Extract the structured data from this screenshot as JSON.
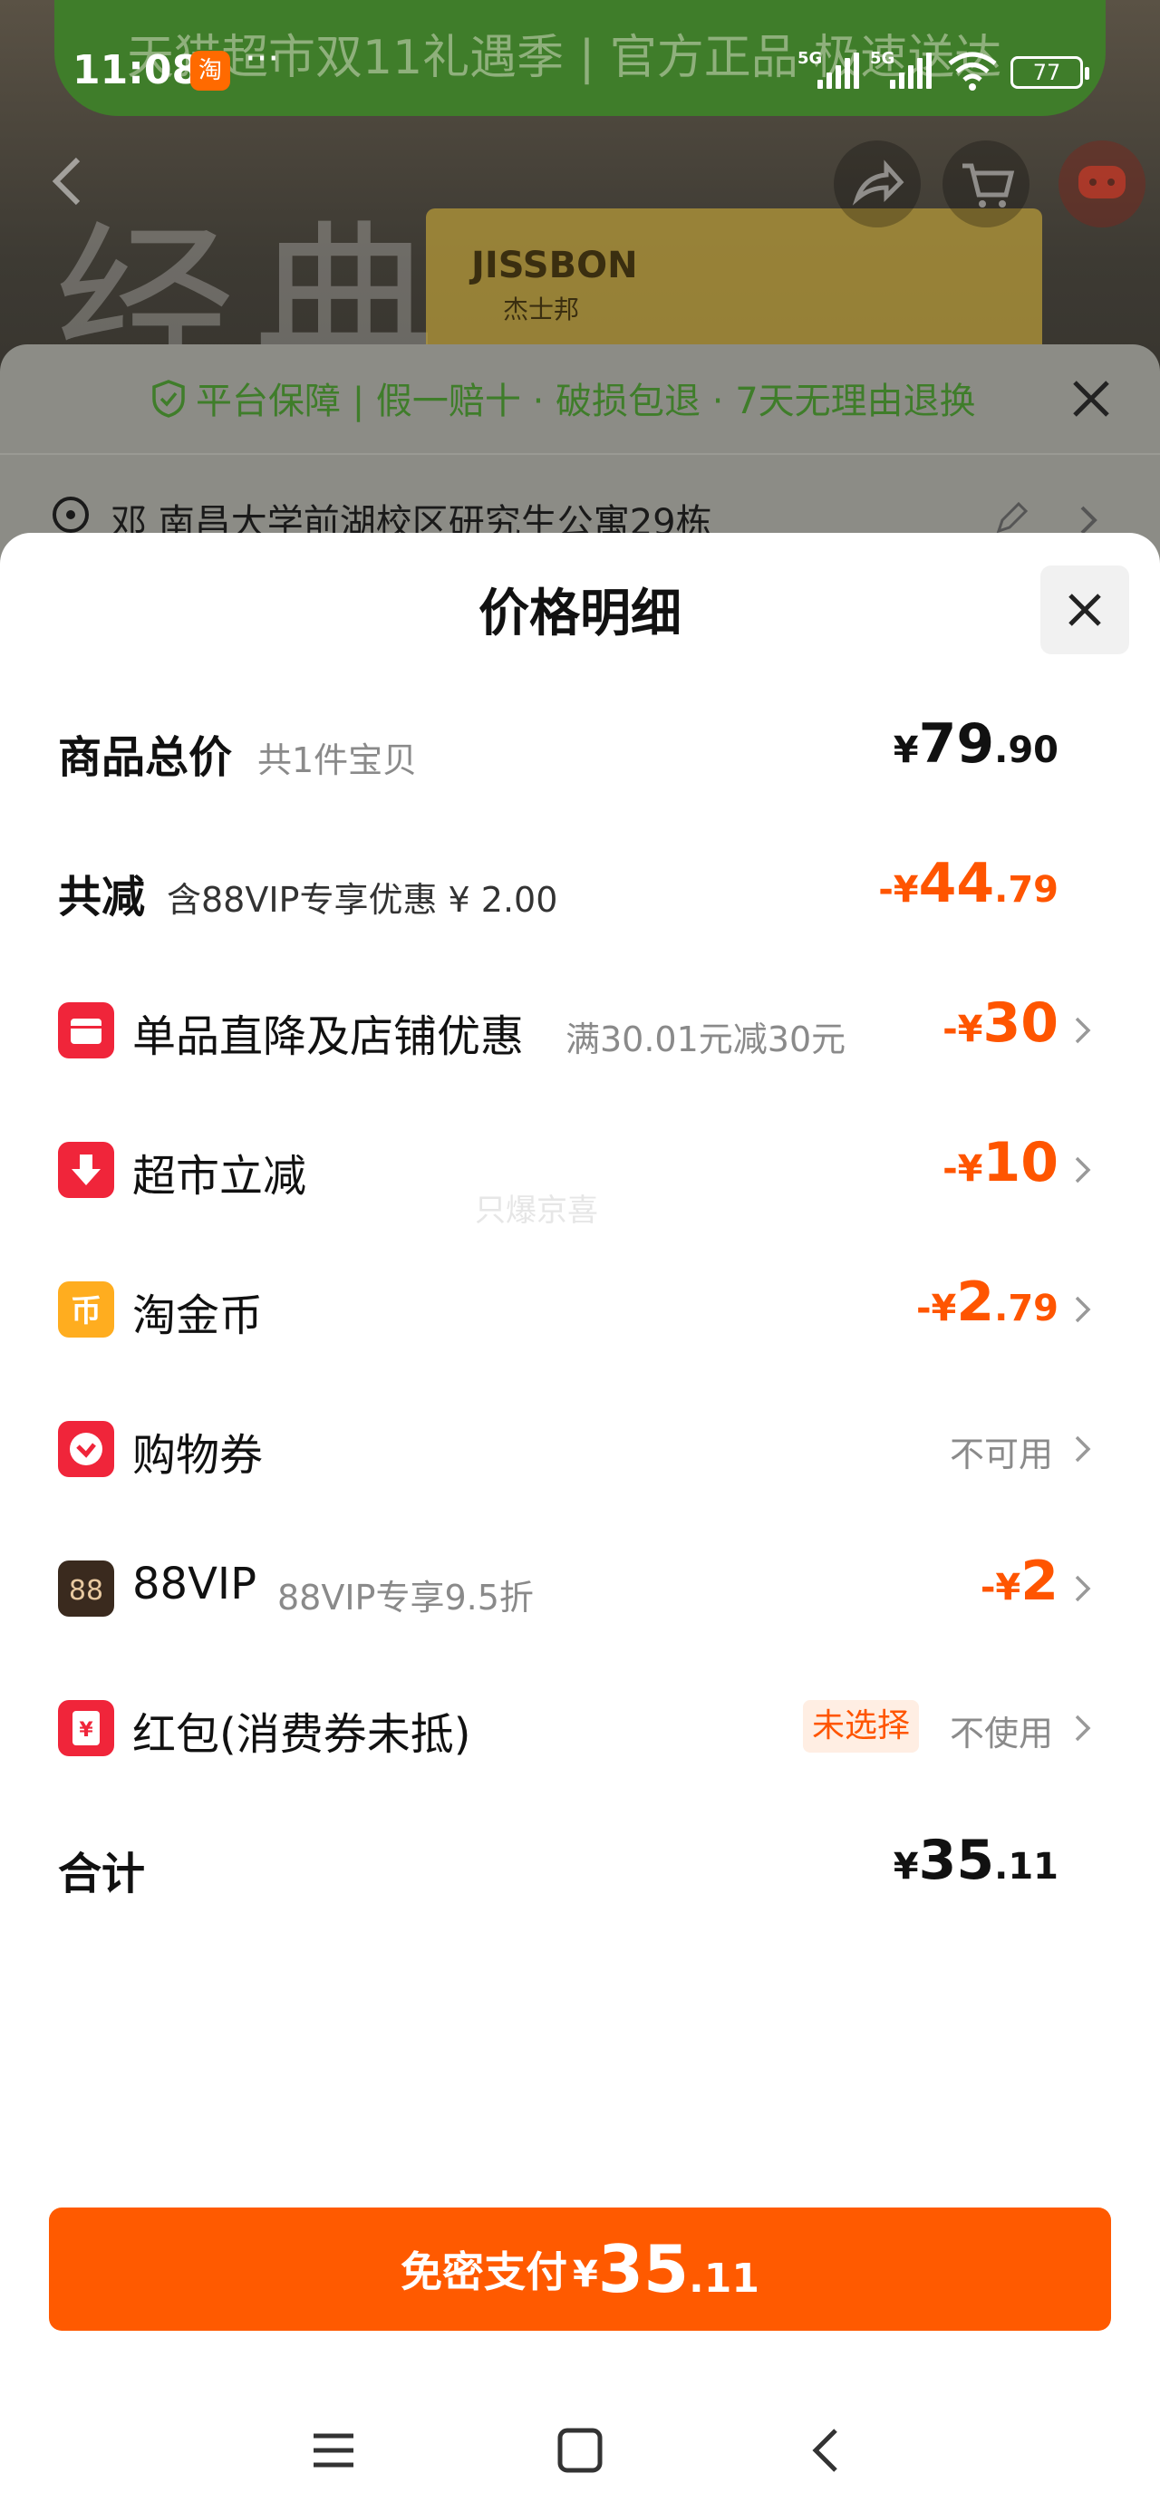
{
  "status_bar": {
    "time": "11:08",
    "app_badge": "淘",
    "dots": "···",
    "network1": "5G",
    "network2": "5G",
    "battery": "77"
  },
  "background": {
    "banner": "天猫超市双11礼遇季 | 官方正品 极速送达",
    "big_text": "经典",
    "brand": "JISSBON",
    "brand_cn": "杰士邦",
    "guarantee": "平台保障 | 假一赔十 · 破损包退 · 7天无理由退换",
    "address": "邓  南昌大学前湖校区研究生公寓29栋"
  },
  "sheet": {
    "title": "价格明细",
    "watermark": "只爆京喜",
    "rows": {
      "total": {
        "label": "商品总价",
        "sub": "共1件宝贝",
        "sym": "¥",
        "big": "79",
        "small": ".90"
      },
      "reduce": {
        "label": "共减",
        "sub": "含88VIP专享优惠 ¥ 2.00",
        "sym": "-¥",
        "big": "44",
        "small": ".79"
      },
      "shop": {
        "label": "单品直降及店铺优惠",
        "sub": "满30.01元减30元",
        "sym": "-¥",
        "big": "30",
        "small": ""
      },
      "market": {
        "label": "超市立减",
        "sym": "-¥",
        "big": "10",
        "small": ""
      },
      "coin": {
        "label": "淘金币",
        "sym": "-¥",
        "big": "2",
        "small": ".79"
      },
      "voucher": {
        "label": "购物券",
        "status": "不可用"
      },
      "vip": {
        "label": "88VIP",
        "sub": "88VIP专享9.5折",
        "sym": "-¥",
        "big": "2",
        "small": ""
      },
      "redpacket": {
        "label": "红包(消费券未抵)",
        "tag": "未选择",
        "status": "不使用"
      },
      "sum": {
        "label": "合计",
        "sym": "¥",
        "big": "35",
        "small": ".11"
      }
    },
    "pay": {
      "label": "免密支付",
      "sym": "¥",
      "big": "35",
      "small": ".11"
    }
  },
  "colors": {
    "accent": "#ff5500",
    "pay_button": "#ff5a00",
    "red_icon": "#f0253a",
    "coin_icon": "#ffad1f",
    "vip_icon": "#3a2a1e"
  }
}
